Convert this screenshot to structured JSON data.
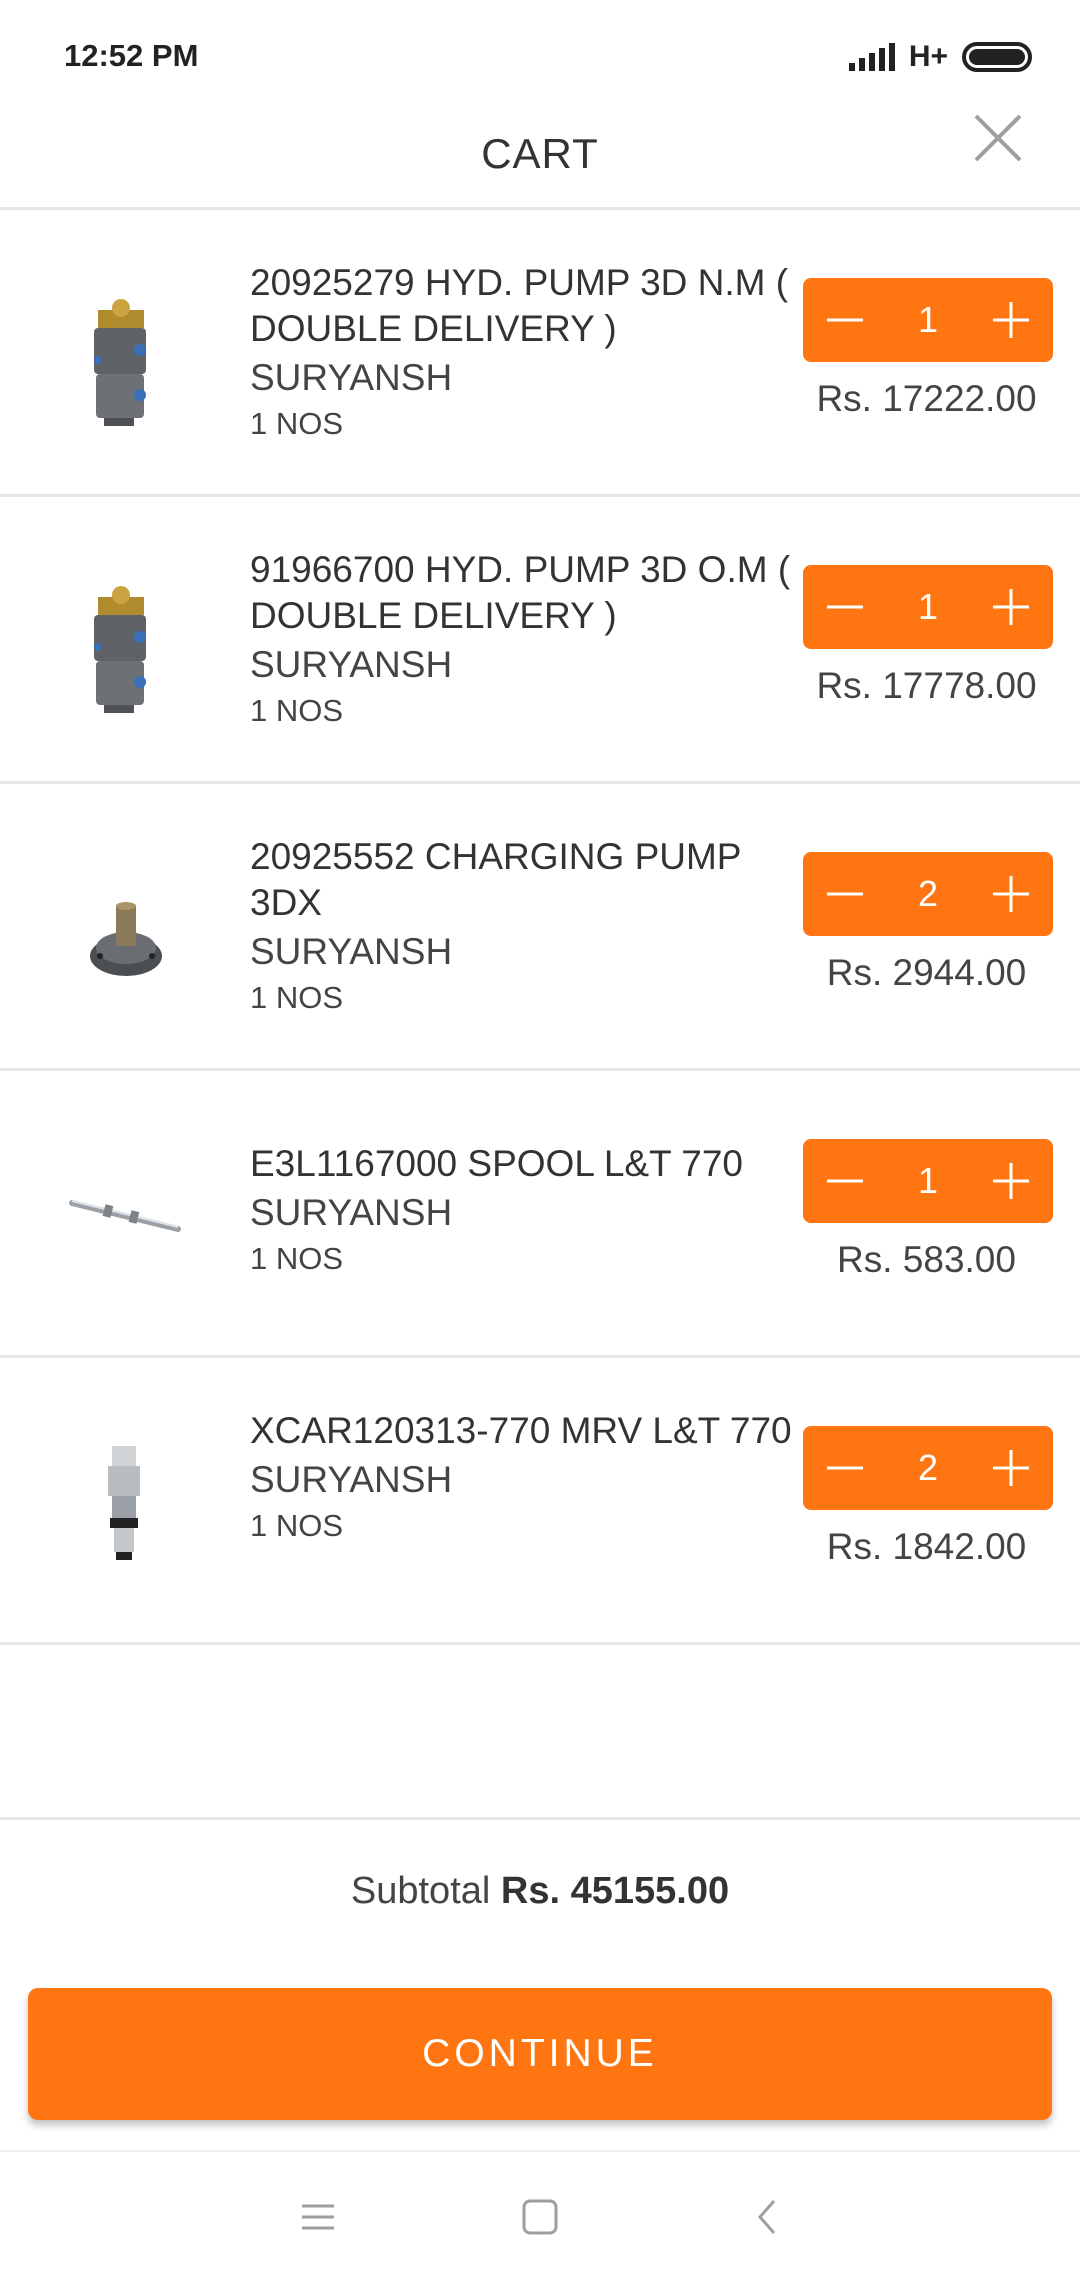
{
  "status_bar": {
    "time": "12:52 PM",
    "network": "H+"
  },
  "header": {
    "title": "CART"
  },
  "items": [
    {
      "name": "20925279 HYD. PUMP 3D N.M ( DOUBLE DELIVERY )",
      "vendor": "SURYANSH",
      "unit": "1 NOS",
      "qty": "1",
      "price": "Rs. 17222.00",
      "image": "hydraulic-pump"
    },
    {
      "name": "91966700 HYD. PUMP 3D O.M ( DOUBLE DELIVERY )",
      "vendor": "SURYANSH",
      "unit": "1 NOS",
      "qty": "1",
      "price": "Rs. 17778.00",
      "image": "hydraulic-pump"
    },
    {
      "name": "20925552 CHARGING PUMP 3DX",
      "vendor": "SURYANSH",
      "unit": "1 NOS",
      "qty": "2",
      "price": "Rs. 2944.00",
      "image": "charging-pump"
    },
    {
      "name": "E3L1167000 SPOOL L&T 770",
      "vendor": "SURYANSH",
      "unit": "1 NOS",
      "qty": "1",
      "price": "Rs. 583.00",
      "image": "spool"
    },
    {
      "name": "XCAR120313-770 MRV L&T 770",
      "vendor": "SURYANSH",
      "unit": "1 NOS",
      "qty": "2",
      "price": "Rs. 1842.00",
      "image": "relief-valve"
    }
  ],
  "footer": {
    "subtotal_label": "Subtotal",
    "subtotal_value": "Rs. 45155.00",
    "continue_label": "CONTINUE"
  },
  "colors": {
    "accent": "#fe7512",
    "divider": "#e6e6e6",
    "text": "#333333"
  },
  "icons": {
    "close": "close-icon",
    "minus": "minus-icon",
    "plus": "plus-icon",
    "nav_menu": "menu-icon",
    "nav_home": "home-icon",
    "nav_back": "back-icon"
  }
}
